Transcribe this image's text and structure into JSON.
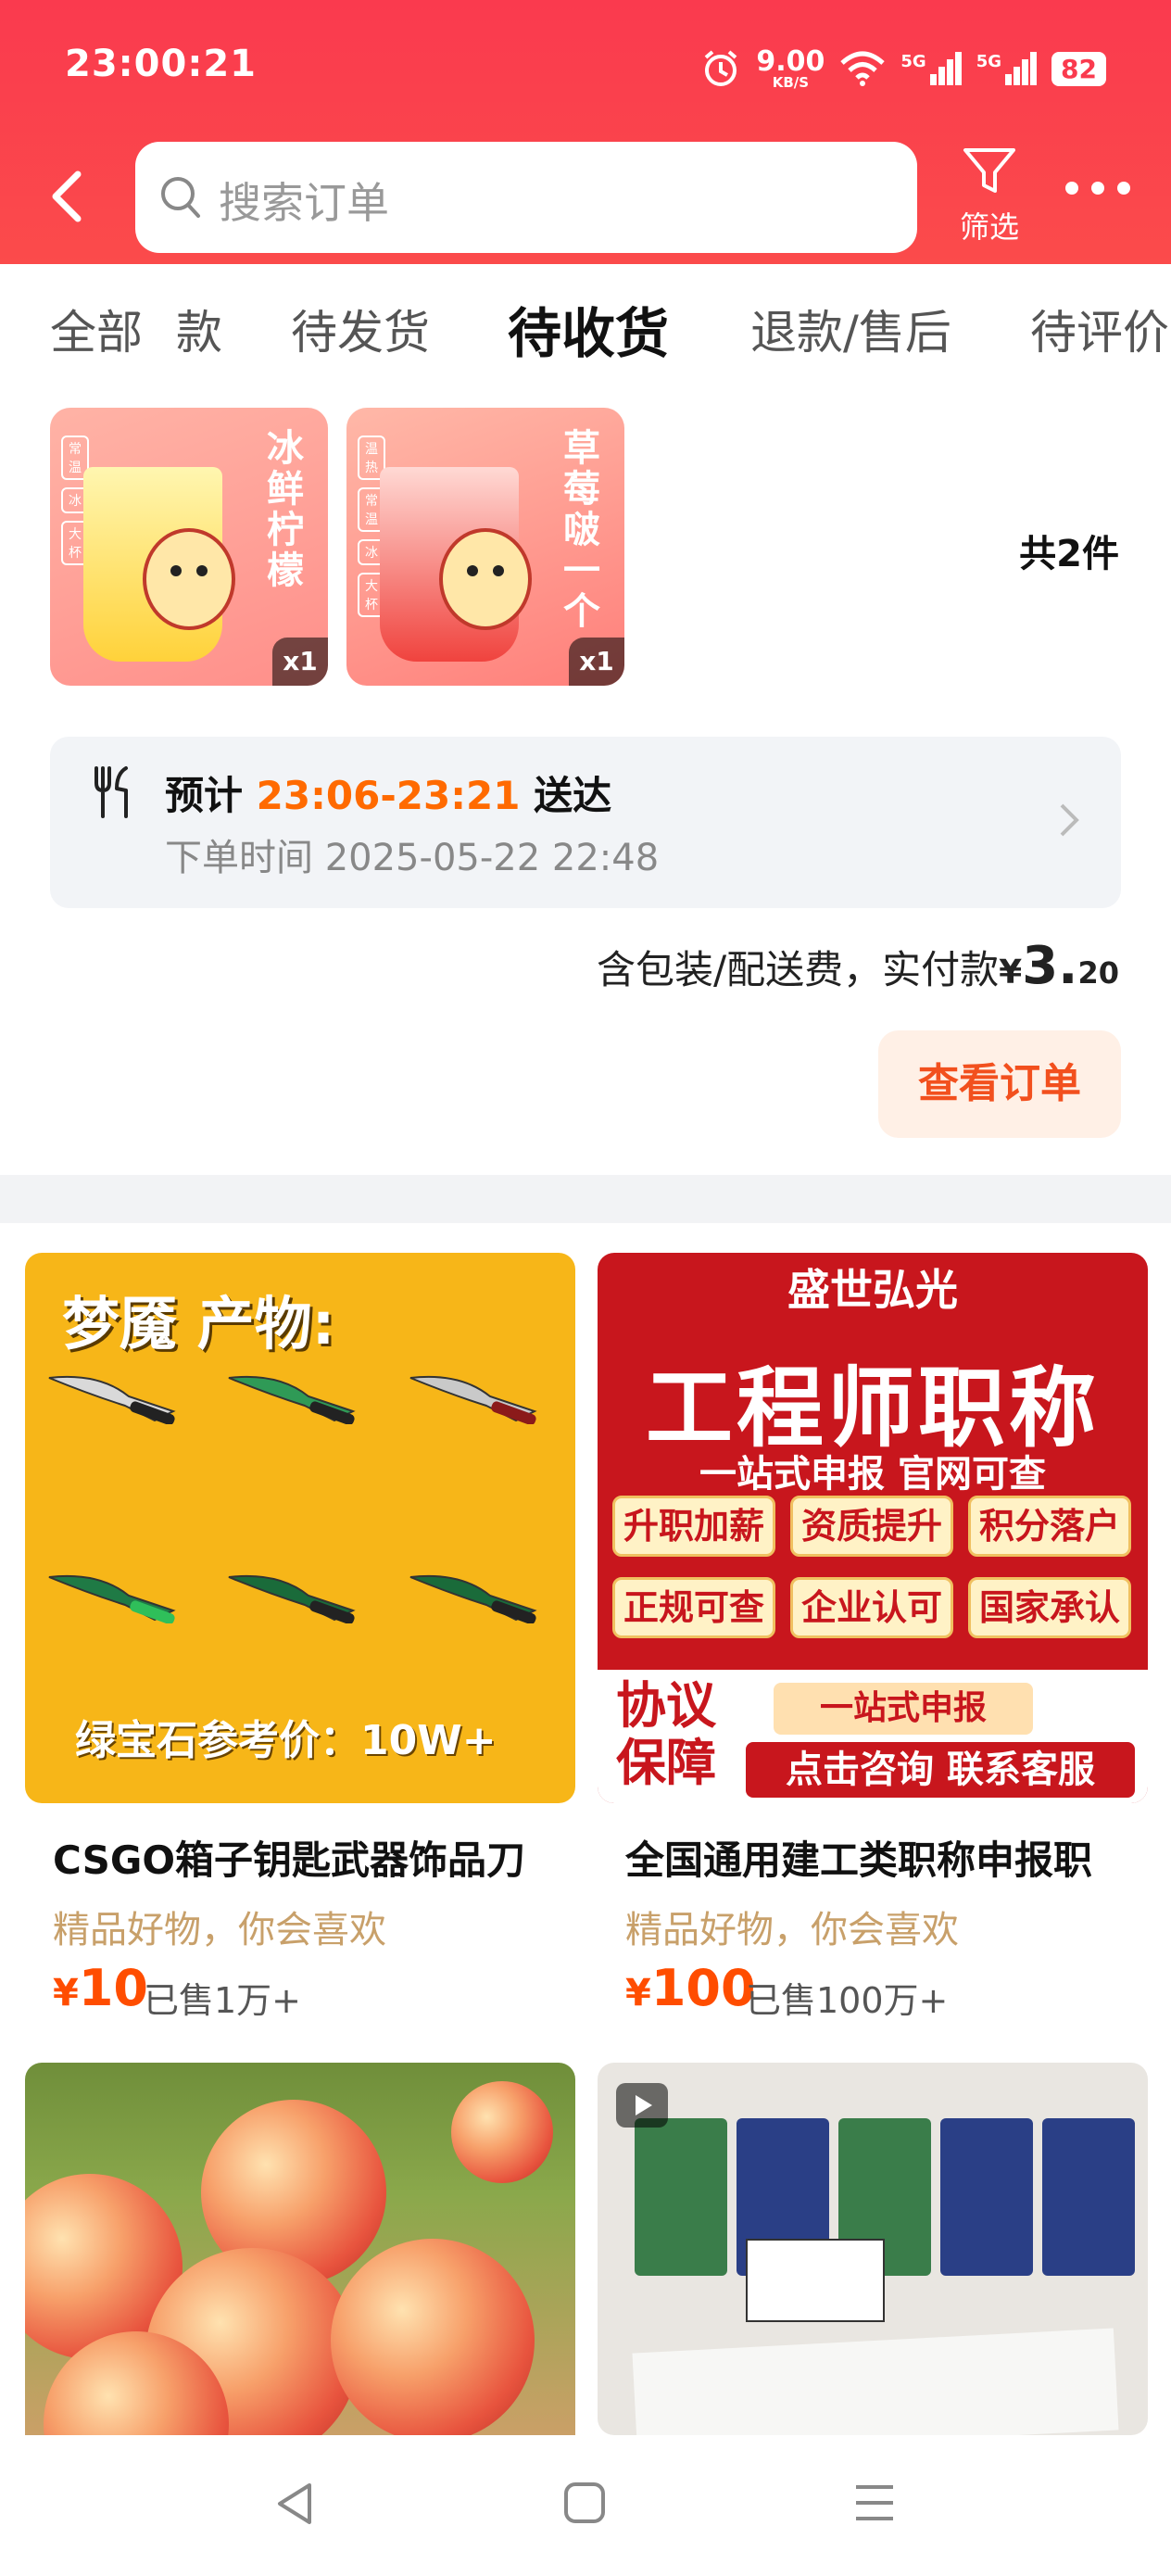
{
  "status_bar": {
    "time": "23:00:21",
    "net_speed": "9.00",
    "net_unit": "KB/S",
    "sim1": "5G",
    "sim2": "5G",
    "battery": "82"
  },
  "header": {
    "search_placeholder": "搜索订单",
    "filter_label": "筛选",
    "icons": [
      "back-icon",
      "search-icon",
      "filter-icon",
      "more-icon"
    ]
  },
  "tabs": [
    {
      "label": "全部"
    },
    {
      "label": "款"
    },
    {
      "label": "待发货"
    },
    {
      "label": "待收货",
      "active": true
    },
    {
      "label": "退款/售后"
    },
    {
      "label": "待评价"
    }
  ],
  "order": {
    "items": [
      {
        "name_vertical": "冰鲜柠檬",
        "tags": [
          "常温",
          "冰",
          "大杯"
        ],
        "qty": "x1",
        "color": "#f6a623"
      },
      {
        "name_vertical": "草莓啵一个",
        "tags": [
          "温热",
          "常温",
          "冰",
          "大杯"
        ],
        "qty": "x1",
        "color": "#e8413c"
      }
    ],
    "total_count": "共2件",
    "delivery": {
      "prefix": "预计",
      "eta": "23:06-23:21",
      "suffix": "送达",
      "order_time": "下单时间 2025-05-22 22:48"
    },
    "payment": {
      "label": "含包装/配送费，实付款",
      "currency": "¥",
      "int": "3.",
      "dec": "20"
    },
    "view_button": "查看订单"
  },
  "products": [
    {
      "img_heading": "梦魇 产物:",
      "img_footer": "绿宝石参考价：10W+",
      "title": "CSGO箱子钥匙武器饰品刀",
      "subtitle": "精品好物，你会喜欢",
      "currency": "¥",
      "price": "10",
      "sold": "已售1万+"
    },
    {
      "img_top": "盛世弘光",
      "img_big": "工程师职称",
      "img_mid": "一站式申报 官网可查",
      "img_chips": [
        "升职加薪",
        "资质提升",
        "积分落户",
        "正规可查",
        "企业认可",
        "国家承认"
      ],
      "img_xieyi": "协议保障",
      "img_pill1": "一站式申报",
      "img_pill2": "点击咨询 联系客服",
      "title": "全国通用建工类职称申报职",
      "subtitle": "精品好物，你会喜欢",
      "currency": "¥",
      "price": "100",
      "sold": "已售100万+"
    },
    {
      "image": "peaches"
    },
    {
      "image": "tissue-packs",
      "video": true
    }
  ],
  "colors": {
    "header_red": "#fa3a4e",
    "eta_orange": "#ff6a00",
    "button_text": "#f2501e",
    "price_orange": "#ff4d00",
    "subtitle_tan": "#c8a06a"
  }
}
